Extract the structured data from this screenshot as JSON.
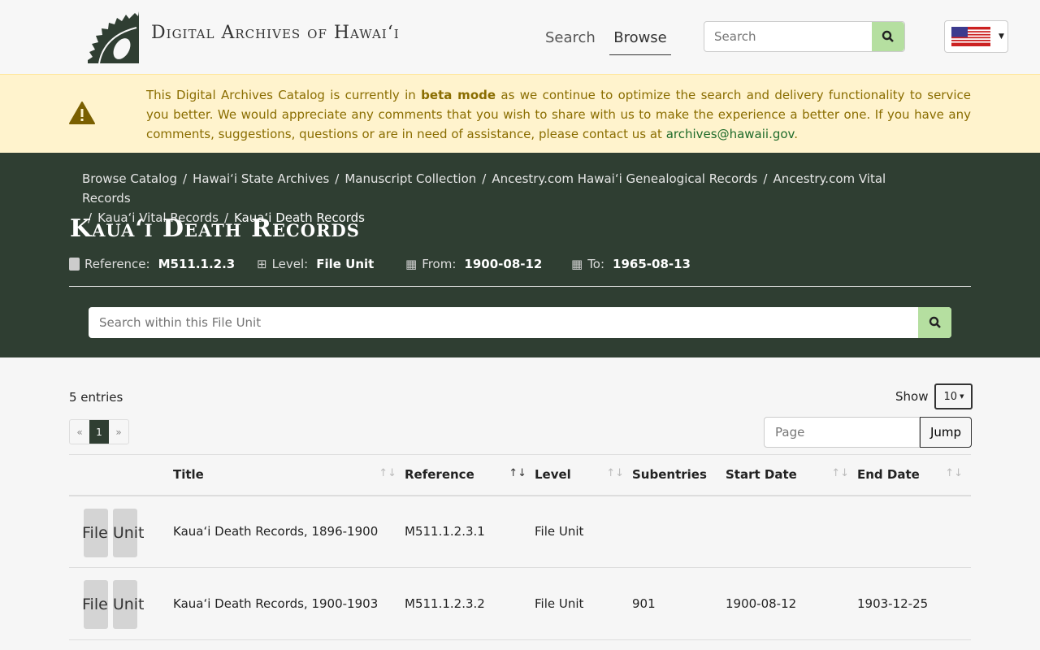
{
  "header": {
    "site_title": "Digital Archives of Hawaiʻi",
    "nav": [
      {
        "label": "Search"
      },
      {
        "label": "Browse"
      }
    ],
    "search_placeholder": "Search"
  },
  "alert": {
    "text_before": "This Digital Archives Catalog is currently in ",
    "bold": "beta mode",
    "text_after": " as we continue to optimize the search and delivery functionality to service you better. We would appreciate any comments that you wish to share with us to make the experience a better one. If you have any comments, suggestions, questions or are in need of assistance, please contact us at ",
    "email": "archives@hawaii.gov",
    "end": "."
  },
  "breadcrumb": [
    "Browse Catalog",
    "Hawai‘i State Archives",
    "Manuscript Collection",
    "Ancestry.com Hawai‘i Genealogical Records",
    "Ancestry.com Vital Records",
    "Kaua‘i Vital Records",
    "Kaua‘i Death Records"
  ],
  "page": {
    "title": "Kaua‘i Death Records",
    "reference_label": "Reference:",
    "reference": "M511.1.2.3",
    "level_label": "Level:",
    "level": "File Unit",
    "from_label": "From:",
    "from": "1900-08-12",
    "to_label": "To:",
    "to": "1965-08-13",
    "search_placeholder": "Search within this File Unit"
  },
  "list": {
    "entries": "5 entries",
    "show_label": "Show",
    "show_value": "10",
    "pages": [
      "«",
      "1",
      "»"
    ],
    "page_placeholder": "Page",
    "jump_label": "Jump",
    "columns": [
      "Title",
      "Reference",
      "Level",
      "Subentries",
      "Start Date",
      "End Date"
    ],
    "rows": [
      {
        "icon_label": "File Unit",
        "title": "Kaua‘i Death Records, 1896-1900",
        "reference": "M511.1.2.3.1",
        "level": "File Unit",
        "subentries": "",
        "start": "",
        "end": ""
      },
      {
        "icon_label": "File Unit",
        "title": "Kaua‘i Death Records, 1900-1903",
        "reference": "M511.1.2.3.2",
        "level": "File Unit",
        "subentries": "901",
        "start": "1900-08-12",
        "end": "1903-12-25"
      }
    ]
  },
  "colors": {
    "dark": "#2f3e32",
    "accent": "#b5dfa0",
    "alert": "#fff3cd"
  }
}
